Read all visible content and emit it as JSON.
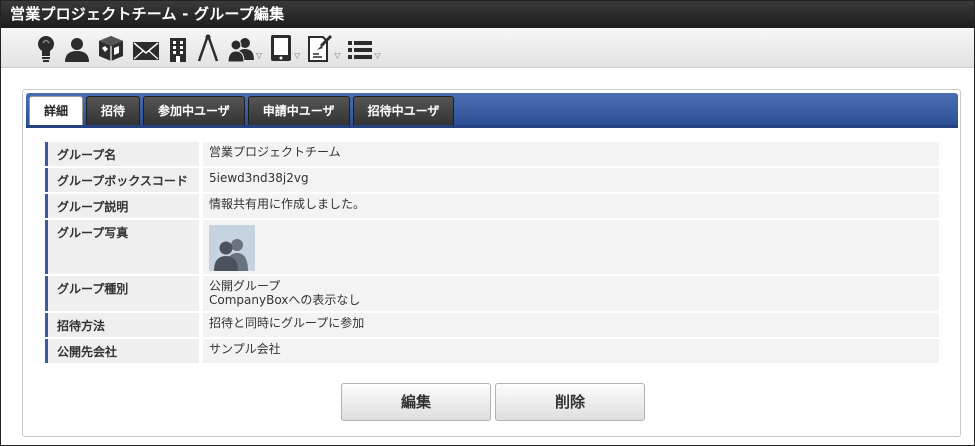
{
  "window": {
    "title": "営業プロジェクトチーム - グループ編集"
  },
  "toolbar": {
    "icons": [
      {
        "name": "lightbulb-icon"
      },
      {
        "name": "user-icon"
      },
      {
        "name": "box-icon"
      },
      {
        "name": "mail-icon"
      },
      {
        "name": "building-icon"
      },
      {
        "name": "compass-icon"
      },
      {
        "name": "group-icon",
        "dropdown": true
      },
      {
        "name": "device-icon",
        "dropdown": true
      },
      {
        "name": "document-pin-icon",
        "dropdown": true
      },
      {
        "name": "list-icon",
        "dropdown": true
      }
    ],
    "caret": "▽"
  },
  "tabs": [
    {
      "label": "詳細",
      "active": true
    },
    {
      "label": "招待",
      "active": false
    },
    {
      "label": "参加中ユーザ",
      "active": false
    },
    {
      "label": "申請中ユーザ",
      "active": false
    },
    {
      "label": "招待中ユーザ",
      "active": false
    }
  ],
  "details": {
    "group_name": {
      "label": "グループ名",
      "value": "営業プロジェクトチーム"
    },
    "box_code": {
      "label": "グループボックスコード",
      "value": "5iewd3nd38j2vg"
    },
    "description": {
      "label": "グループ説明",
      "value": "情報共有用に作成しました。"
    },
    "photo": {
      "label": "グループ写真",
      "icon": "group-avatar-icon"
    },
    "type": {
      "label": "グループ種別",
      "value_line1": "公開グループ",
      "value_line2": "CompanyBoxへの表示なし"
    },
    "invite_method": {
      "label": "招待方法",
      "value": "招待と同時にグループに参加"
    },
    "public_company": {
      "label": "公開先会社",
      "value": "サンプル会社"
    }
  },
  "buttons": {
    "edit": "編集",
    "delete": "削除"
  },
  "colors": {
    "tab_bar": "#2d4f93",
    "label_accent": "#3a5b9e",
    "title_bar": "#1c1c1c"
  }
}
